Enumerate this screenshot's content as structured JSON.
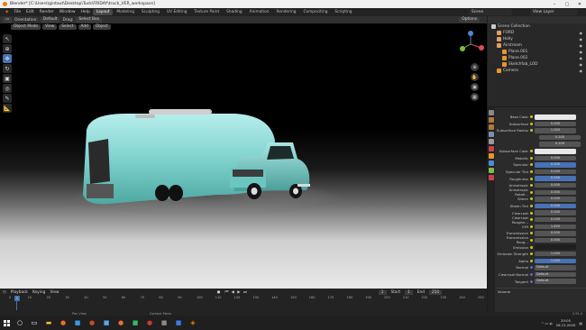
{
  "window": {
    "title": "Blender* [C:\\Users\\gintaut\\Desktop\\Tuck\\FRIDAY\\truck_VER_workspace]",
    "controls": [
      "–",
      "▢",
      "✕"
    ]
  },
  "menu": {
    "items": [
      "File",
      "Edit",
      "Render",
      "Window",
      "Help"
    ],
    "workspaces": [
      "Layout",
      "Modeling",
      "Sculpting",
      "UV Editing",
      "Texture Paint",
      "Shading",
      "Animation",
      "Rendering",
      "Compositing",
      "Scripting"
    ],
    "active_workspace": "Layout",
    "scene": "Scene",
    "view_layer": "View Layer"
  },
  "viewport_header": {
    "orientation_label": "Orientation:",
    "orientation_value": "Default",
    "drag_label": "Drag:",
    "drag_value": "Select Box",
    "mode": "Object Mode",
    "menus": [
      "View",
      "Select",
      "Add",
      "Object"
    ],
    "options": "Options"
  },
  "outliner": {
    "rows": [
      {
        "label": "Scene Collection",
        "indent": 0,
        "color": "#cccccc"
      },
      {
        "label": "FORD",
        "indent": 1,
        "color": "#e0a060"
      },
      {
        "label": "Holly",
        "indent": 1,
        "color": "#e0a060"
      },
      {
        "label": "Airstream",
        "indent": 1,
        "color": "#e0a060"
      },
      {
        "label": "Plane.001",
        "indent": 2,
        "color": "#e8952a"
      },
      {
        "label": "Plane.002",
        "indent": 2,
        "color": "#e8952a"
      },
      {
        "label": "Sketchfab_LOD",
        "indent": 2,
        "color": "#e8952a"
      },
      {
        "label": "Camera",
        "indent": 1,
        "color": "#e8952a"
      }
    ]
  },
  "properties": {
    "header": "Principled BSDF",
    "rows": [
      {
        "label": "Base Color",
        "value": "",
        "style": "white"
      },
      {
        "label": "Subsurface",
        "value": "0.000",
        "style": ""
      },
      {
        "label": "Subsurface Radius",
        "value": "1.000",
        "style": ""
      },
      {
        "label": "",
        "value": "0.200",
        "style": "sm"
      },
      {
        "label": "",
        "value": "0.100",
        "style": "sm"
      },
      {
        "label": "Subsurface Color",
        "value": "",
        "style": "white"
      },
      {
        "label": "Metallic",
        "value": "0.000",
        "style": ""
      },
      {
        "label": "Specular",
        "value": "0.500",
        "style": "blue"
      },
      {
        "label": "Specular Tint",
        "value": "0.000",
        "style": ""
      },
      {
        "label": "Roughness",
        "value": "0.500",
        "style": "blue"
      },
      {
        "label": "Anisotropic",
        "value": "0.000",
        "style": ""
      },
      {
        "label": "Anisotropic Rotati...",
        "value": "0.000",
        "style": ""
      },
      {
        "label": "Sheen",
        "value": "0.000",
        "style": ""
      },
      {
        "label": "Sheen Tint",
        "value": "0.500",
        "style": "blue"
      },
      {
        "label": "Clearcoat",
        "value": "0.000",
        "style": ""
      },
      {
        "label": "Clearcoat Roughn...",
        "value": "0.030",
        "style": ""
      },
      {
        "label": "IOR",
        "value": "1.450",
        "style": ""
      },
      {
        "label": "Transmission",
        "value": "0.000",
        "style": ""
      },
      {
        "label": "Transmission Roug...",
        "value": "0.000",
        "style": ""
      },
      {
        "label": "Emission",
        "value": "",
        "style": "dark"
      },
      {
        "label": "Emission Strength",
        "value": "1.000",
        "style": ""
      },
      {
        "label": "Alpha",
        "value": "1.000",
        "style": "blue"
      },
      {
        "label": "Normal",
        "value": "Default",
        "style": "left"
      },
      {
        "label": "Clearcoat Normal",
        "value": "Default",
        "style": "left"
      },
      {
        "label": "Tangent",
        "value": "Default",
        "style": "left"
      },
      {
        "label": "Volume",
        "value": "",
        "style": "section"
      }
    ]
  },
  "timeline": {
    "menus": [
      "Playback",
      "Keying",
      "View"
    ],
    "current_frame": "1",
    "start_label": "Start",
    "start": "1",
    "end_label": "End",
    "end": "250",
    "ticks": [
      "0",
      "10",
      "20",
      "30",
      "40",
      "50",
      "60",
      "70",
      "80",
      "90",
      "100",
      "110",
      "120",
      "130",
      "140",
      "150",
      "160",
      "170",
      "180",
      "190",
      "200",
      "210",
      "220",
      "230",
      "240",
      "250"
    ]
  },
  "statusbar": {
    "left": "Pan View",
    "middle": "Context Menu",
    "version": "2.91.0"
  },
  "taskbar": {
    "time": "20:05",
    "date": "26.11.2020"
  },
  "colors": {
    "accent": "#4772b3",
    "trailer": "#8fdad6",
    "truck": "#7fd3cf"
  }
}
